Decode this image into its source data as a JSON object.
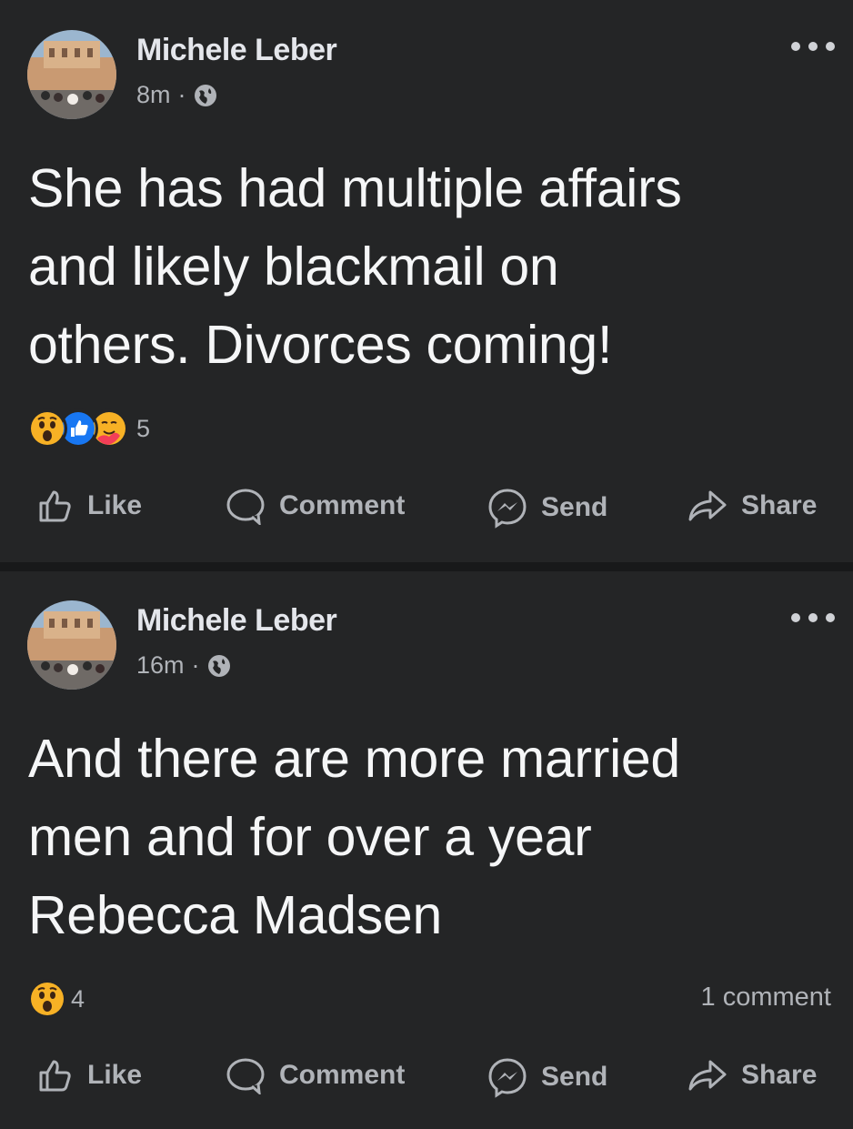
{
  "posts": [
    {
      "author": "Michele Leber",
      "time": "8m",
      "separator": "·",
      "text_lines": [
        "She has had multiple affairs",
        "and likely blackmail on",
        "others.  Divorces coming!"
      ],
      "reactions": [
        "wow",
        "like",
        "care"
      ],
      "reaction_count": "5",
      "comment_count": "",
      "actions": {
        "like": "Like",
        "comment": "Comment",
        "send": "Send",
        "share": "Share"
      }
    },
    {
      "author": "Michele Leber",
      "time": "16m",
      "separator": "·",
      "text_lines": [
        "And there are more married",
        "men and for over a year",
        "Rebecca Madsen"
      ],
      "reactions": [
        "wow"
      ],
      "reaction_count": "4",
      "comment_count": "1 comment",
      "actions": {
        "like": "Like",
        "comment": "Comment",
        "send": "Send",
        "share": "Share"
      }
    }
  ],
  "colors": {
    "background": "#242526",
    "divider": "#18191a",
    "primary_text": "#e4e6eb",
    "secondary_text": "#b0b3b8",
    "like_blue": "#1877f2",
    "wow_yellow": "#f7b125"
  },
  "icons": [
    "globe-icon",
    "more-icon",
    "like-icon",
    "comment-icon",
    "messenger-send-icon",
    "share-icon",
    "wow-reaction-icon",
    "like-reaction-icon",
    "care-reaction-icon"
  ]
}
